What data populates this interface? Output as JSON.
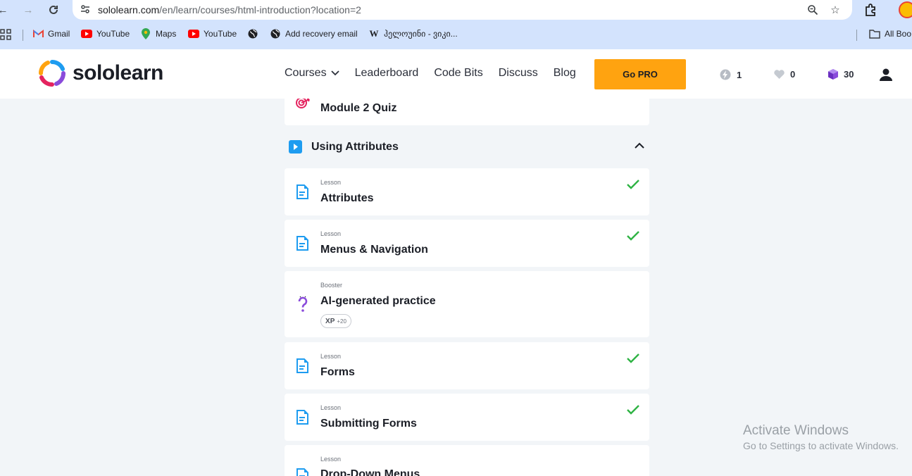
{
  "browser": {
    "url_host": "sololearn.com",
    "url_path": "/en/learn/courses/html-introduction?location=2",
    "bookmarks": [
      {
        "label": "Gmail",
        "icon": "gmail-icon"
      },
      {
        "label": "YouTube",
        "icon": "youtube-icon"
      },
      {
        "label": "Maps",
        "icon": "maps-icon"
      },
      {
        "label": "YouTube",
        "icon": "youtube-icon"
      },
      {
        "label": "",
        "icon": "globe-icon"
      },
      {
        "label": "Add recovery email",
        "icon": "globe-icon"
      },
      {
        "label": "ჰელოუინი - ვიკი...",
        "icon": "wikipedia-icon"
      }
    ],
    "all_bookmarks_label": "All Boo"
  },
  "header": {
    "logo_text": "sololearn",
    "nav": {
      "courses": "Courses",
      "leaderboard": "Leaderboard",
      "code_bits": "Code Bits",
      "discuss": "Discuss",
      "blog": "Blog"
    },
    "go_pro": "Go PRO",
    "streak": "1",
    "hearts": "0",
    "bits": "30",
    "colors": {
      "accent": "#ffa310",
      "brand_blue": "#1e9cf0"
    }
  },
  "course": {
    "quiz_title": "Module 2 Quiz",
    "module_title": "Using Attributes",
    "items": [
      {
        "type": "Lesson",
        "title": "Attributes",
        "completed": true
      },
      {
        "type": "Lesson",
        "title": "Menus & Navigation",
        "completed": true
      },
      {
        "type": "Booster",
        "title": "AI-generated practice",
        "xp_label": "XP",
        "xp_amount": "+20"
      },
      {
        "type": "Lesson",
        "title": "Forms",
        "completed": true
      },
      {
        "type": "Lesson",
        "title": "Submitting Forms",
        "completed": true
      },
      {
        "type": "Lesson",
        "title": "Drop-Down Menus"
      }
    ]
  },
  "watermark": {
    "line1": "Activate Windows",
    "line2": "Go to Settings to activate Windows."
  }
}
